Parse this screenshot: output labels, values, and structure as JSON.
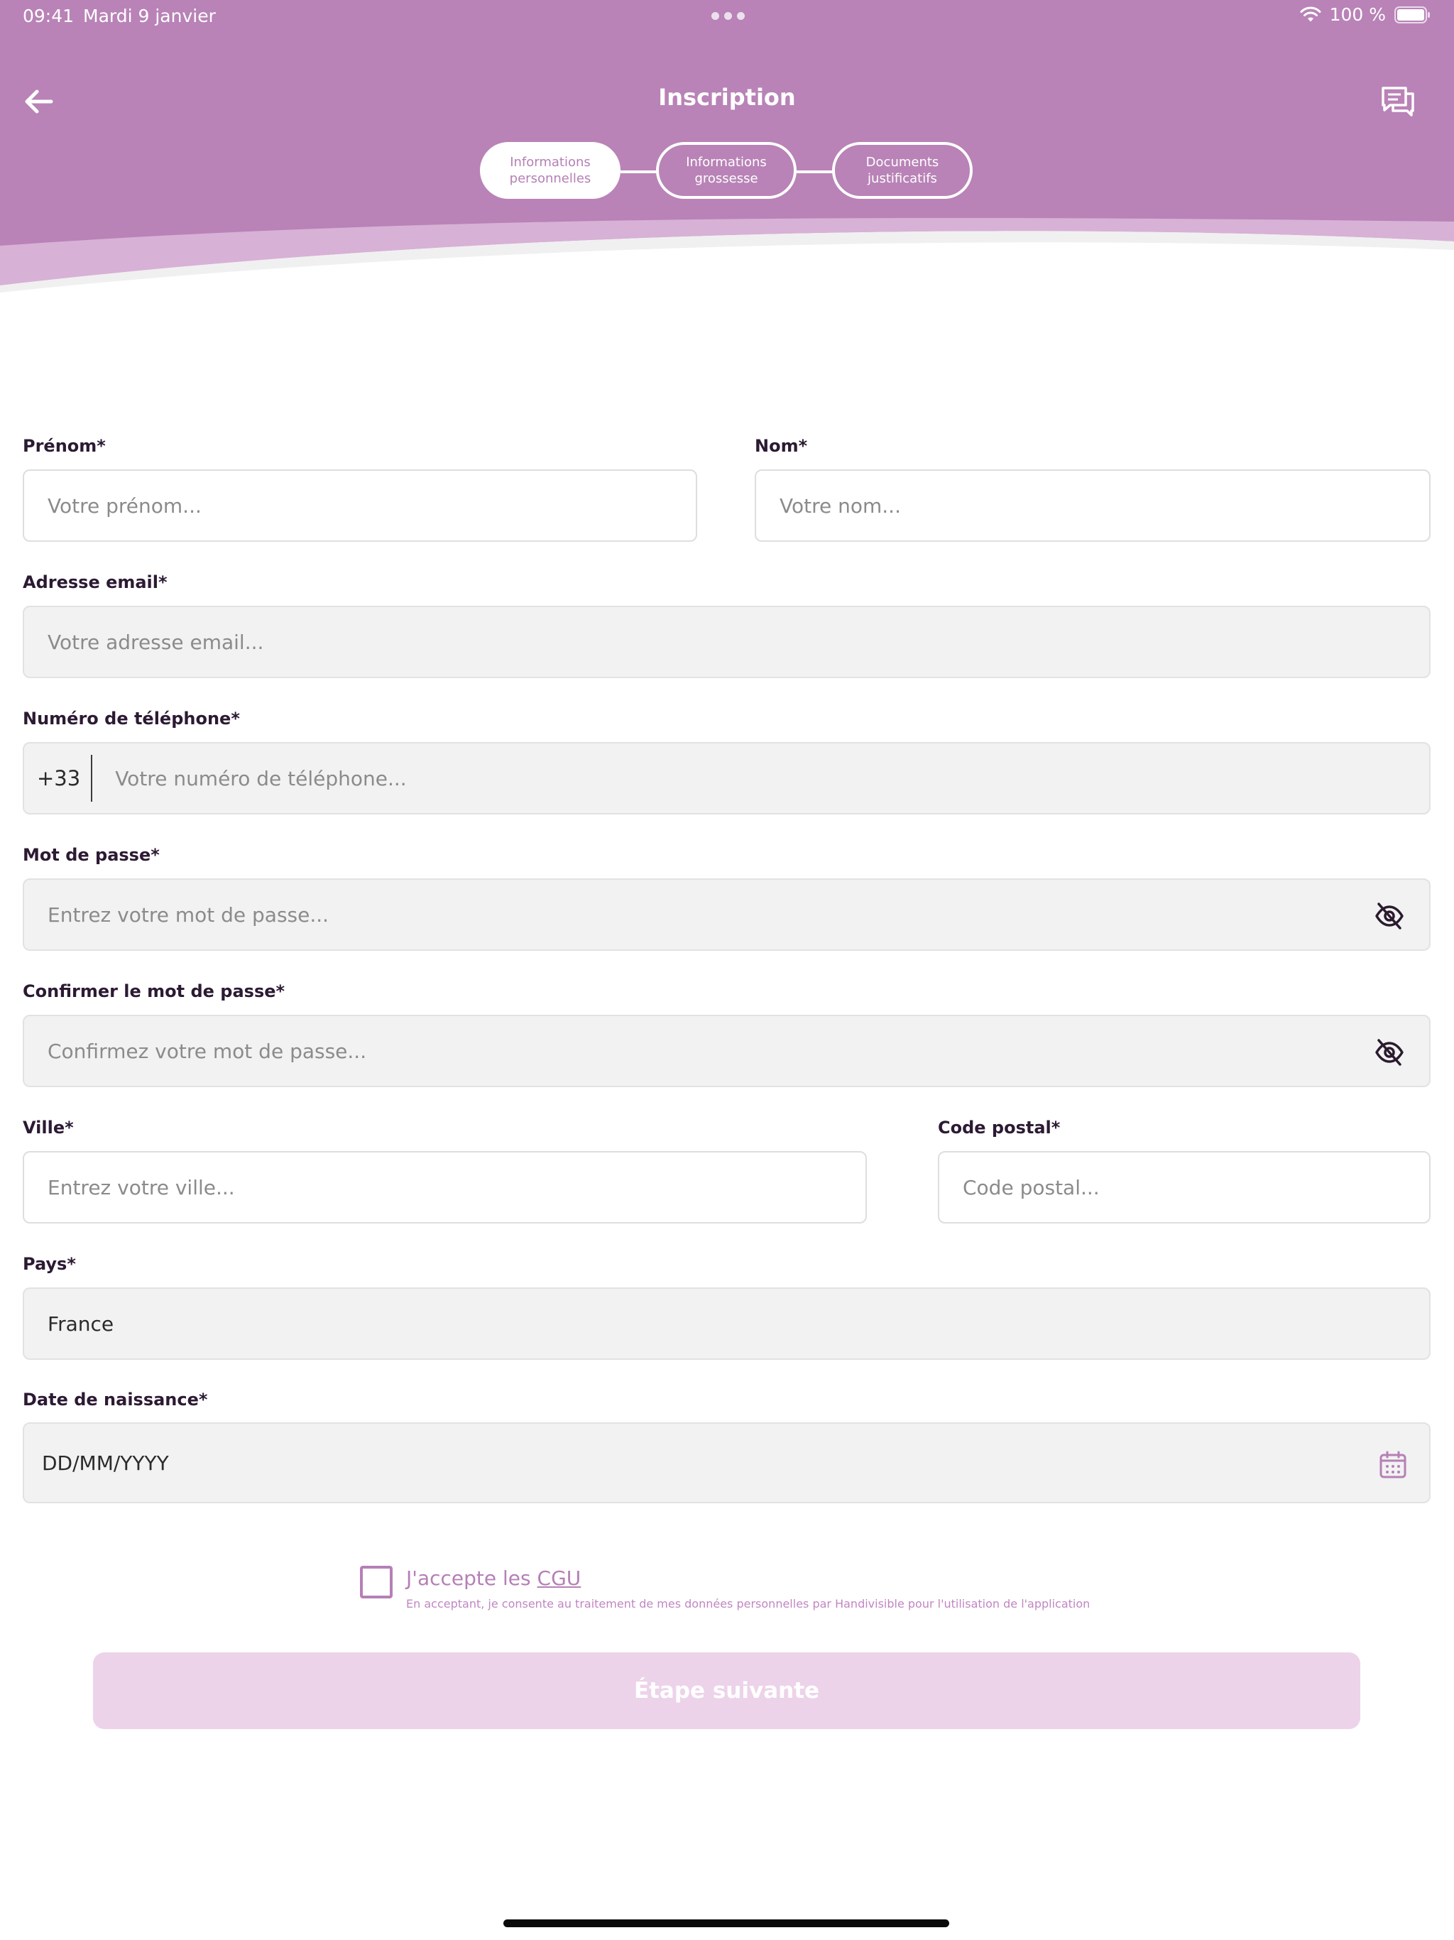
{
  "colors": {
    "brand": "#b983b7",
    "brand_light": "#d7b1d6",
    "button_disabled": "#ecd3e9",
    "checkbox_accent": "#b580b6"
  },
  "status_bar": {
    "time": "09:41",
    "date": "Mardi 9 janvier",
    "battery": "100 %",
    "icons": [
      "wifi-icon",
      "battery-icon"
    ]
  },
  "header": {
    "title": "Inscription",
    "back_icon": "arrow-left-icon",
    "chat_icon": "chat-bubbles-icon"
  },
  "stepper": {
    "steps": [
      {
        "label": "Informations\npersonnelles",
        "active": true
      },
      {
        "label": "Informations\ngrossesse",
        "active": false
      },
      {
        "label": "Documents\njustificatifs",
        "active": false
      }
    ]
  },
  "form": {
    "prenom": {
      "label": "Prénom*",
      "placeholder": "Votre prénom..."
    },
    "nom": {
      "label": "Nom*",
      "placeholder": "Votre nom..."
    },
    "email": {
      "label": "Adresse email*",
      "placeholder": "Votre adresse email..."
    },
    "telephone": {
      "label": "Numéro de téléphone*",
      "prefix": "+33",
      "placeholder": "Votre numéro de téléphone..."
    },
    "mot_de_passe": {
      "label": "Mot de passe*",
      "placeholder": "Entrez votre mot de passe...",
      "icon": "eye-off-icon"
    },
    "confirmer": {
      "label": "Confirmer le mot de passe*",
      "placeholder": "Confirmez votre mot de passe...",
      "icon": "eye-off-icon"
    },
    "ville": {
      "label": "Ville*",
      "placeholder": "Entrez votre ville..."
    },
    "code_postal": {
      "label": "Code postal*",
      "placeholder": "Code postal..."
    },
    "pays": {
      "label": "Pays*",
      "value": "France"
    },
    "naissance": {
      "label": "Date de naissance*",
      "placeholder": "DD/MM/YYYY",
      "icon": "calendar-icon"
    },
    "cgu": {
      "text": "J'accepte les ",
      "link": "CGU",
      "note": "En acceptant, je consente au traitement de mes données personnelles par Handivisible pour l'utilisation de l'application",
      "checked": false
    },
    "submit": {
      "label": "Étape suivante",
      "disabled": true
    }
  }
}
